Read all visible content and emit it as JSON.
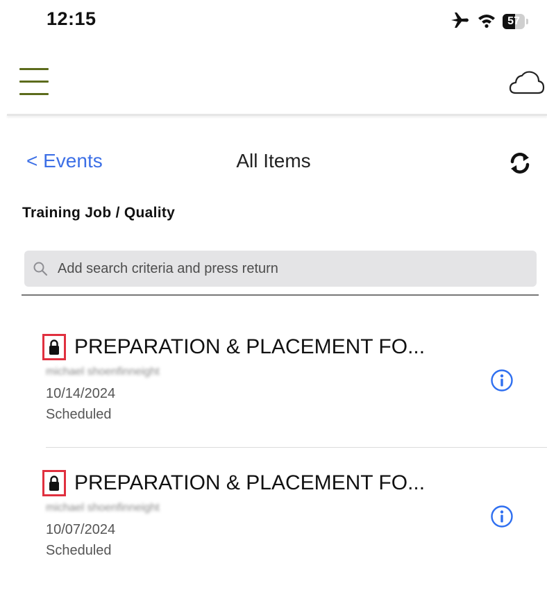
{
  "status_bar": {
    "time": "12:15",
    "icons": [
      "airplane-icon",
      "wifi-icon",
      "battery-icon"
    ],
    "battery_level": "57",
    "battery_fraction": 0.57
  },
  "header": {
    "menu_icon": "hamburger-menu-icon",
    "cloud_icon": "cloud-icon",
    "accent_color": "#5c6b1c"
  },
  "nav": {
    "back_label": "< Events",
    "title": "All Items",
    "refresh_icon": "refresh-icon",
    "link_color": "#3c6fe6"
  },
  "section": {
    "title": "Training Job / Quality"
  },
  "search": {
    "placeholder": "Add search criteria and press return",
    "value": ""
  },
  "items": [
    {
      "title": "PREPARATION & PLACEMENT FO...",
      "owner": "michael shoenfinneight",
      "date": "10/14/2024",
      "status": "Scheduled",
      "icon": "lock-icon"
    },
    {
      "title": "PREPARATION & PLACEMENT FO...",
      "owner": "michael shoenfinneight",
      "date": "10/07/2024",
      "status": "Scheduled",
      "icon": "lock-icon"
    }
  ]
}
